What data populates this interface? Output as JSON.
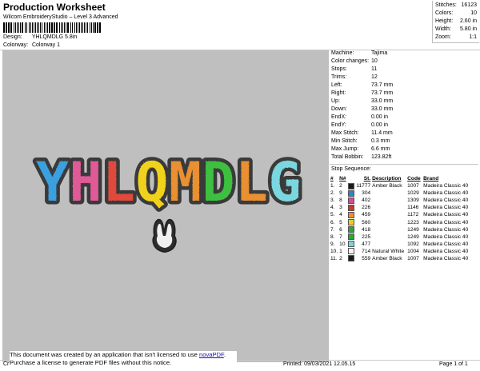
{
  "header": {
    "title": "Production Worksheet",
    "subtitle": "Wilcom EmbroideryStudio – Level 3 Advanced",
    "design_label": "Design:",
    "design_value": "YHLQMDLG 5.8in",
    "colorway_label": "Colorway:",
    "colorway_value": "Colorway 1"
  },
  "stats": [
    {
      "label": "Stitches:",
      "value": "16123"
    },
    {
      "label": "Colors:",
      "value": "10"
    },
    {
      "label": "Height:",
      "value": "2.60 in"
    },
    {
      "label": "Width:",
      "value": "5.80 in"
    },
    {
      "label": "Zoom:",
      "value": "1:1"
    }
  ],
  "design": {
    "text": "YHLQMDLG",
    "letter_colors": [
      "#3aa0e0",
      "#e05a98",
      "#e04a3a",
      "#f0d21a",
      "#e89030",
      "#3ec040",
      "#e89030",
      "#7ad7e0"
    ],
    "outline_color": "#3a3a3a",
    "canvas_color": "#bfbfbf"
  },
  "machine": [
    {
      "label": "Machine:",
      "value": "Tajima"
    },
    {
      "label": "Color changes:",
      "value": "10"
    },
    {
      "label": "Stops:",
      "value": "11"
    },
    {
      "label": "Trims:",
      "value": "12"
    },
    {
      "label": "Left:",
      "value": "73.7 mm"
    },
    {
      "label": "Right:",
      "value": "73.7 mm"
    },
    {
      "label": "Up:",
      "value": "33.0 mm"
    },
    {
      "label": "Down:",
      "value": "33.0 mm"
    },
    {
      "label": "EndX:",
      "value": "0.00 in"
    },
    {
      "label": "EndY:",
      "value": "0.00 in"
    },
    {
      "label": "Max Stitch:",
      "value": "11.4 mm"
    },
    {
      "label": "Min Stitch:",
      "value": "0.3 mm"
    },
    {
      "label": "Max Jump:",
      "value": "6.6 mm"
    },
    {
      "label": "Total Bobbin:",
      "value": "123.82ft"
    }
  ],
  "stop_sequence": {
    "title": "Stop Sequence:",
    "columns": [
      "#",
      "N#",
      "St.",
      "Description",
      "Code",
      "Brand"
    ],
    "rows": [
      {
        "n": "1.",
        "needle": "2",
        "color": "#1a1a1a",
        "st": "11777",
        "desc": "Amber Black",
        "code": "1007",
        "brand": "Madeira Classic 40"
      },
      {
        "n": "2.",
        "needle": "9",
        "color": "#2a86c8",
        "st": "304",
        "desc": "",
        "code": "1029",
        "brand": "Madeira Classic 40"
      },
      {
        "n": "3.",
        "needle": "8",
        "color": "#d24c96",
        "st": "402",
        "desc": "",
        "code": "1309",
        "brand": "Madeira Classic 40"
      },
      {
        "n": "4.",
        "needle": "3",
        "color": "#d8322a",
        "st": "226",
        "desc": "",
        "code": "1146",
        "brand": "Madeira Classic 40"
      },
      {
        "n": "5.",
        "needle": "4",
        "color": "#e89030",
        "st": "459",
        "desc": "",
        "code": "1172",
        "brand": "Madeira Classic 40"
      },
      {
        "n": "6.",
        "needle": "5",
        "color": "#e8d020",
        "st": "560",
        "desc": "",
        "code": "1223",
        "brand": "Madeira Classic 40"
      },
      {
        "n": "7.",
        "needle": "6",
        "color": "#2aa838",
        "st": "418",
        "desc": "",
        "code": "1249",
        "brand": "Madeira Classic 40"
      },
      {
        "n": "8.",
        "needle": "7",
        "color": "#2aa838",
        "st": "225",
        "desc": "",
        "code": "1249",
        "brand": "Madeira Classic 40"
      },
      {
        "n": "9.",
        "needle": "10",
        "color": "#7ad0e8",
        "st": "477",
        "desc": "",
        "code": "1092",
        "brand": "Madeira Classic 40"
      },
      {
        "n": "10.",
        "needle": "1",
        "color": "#f4f4f4",
        "st": "714",
        "desc": "Natural White",
        "code": "1004",
        "brand": "Madeira Classic 40"
      },
      {
        "n": "11.",
        "needle": "2",
        "color": "#1a1a1a",
        "st": "559",
        "desc": "Amber Black",
        "code": "1007",
        "brand": "Madeira Classic 40"
      }
    ]
  },
  "notice": {
    "line1_prefix": "This document was created by an application that isn't licensed to use",
    "link": "novaPDF",
    "line1_suffix": ".",
    "line2": "Purchase a license to generate PDF files without this notice."
  },
  "footer": {
    "left": "Cr",
    "printed": "Printed: 09/03/2021 12.05.15",
    "page": "Page 1 of 1"
  }
}
